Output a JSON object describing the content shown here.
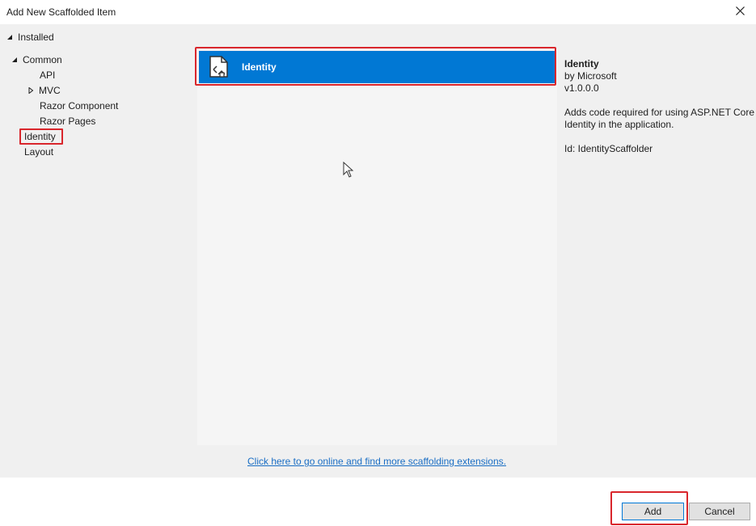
{
  "window": {
    "title": "Add New Scaffolded Item",
    "close_icon": "close-icon"
  },
  "tree": {
    "root_label": "Installed",
    "common_label": "Common",
    "children": [
      "API",
      "MVC",
      "Razor Component",
      "Razor Pages"
    ],
    "identity_label": "Identity",
    "layout_label": "Layout"
  },
  "list": {
    "items": [
      {
        "label": "Identity",
        "icon": "scaffold-document-icon",
        "selected": true
      }
    ]
  },
  "details": {
    "name": "Identity",
    "author": "by Microsoft",
    "version": "v1.0.0.0",
    "description": "Adds code required for using ASP.NET Core Identity in the application.",
    "id_line": "Id: IdentityScaffolder"
  },
  "link": {
    "text": "Click here to go online and find more scaffolding extensions."
  },
  "buttons": {
    "add": "Add",
    "cancel": "Cancel"
  },
  "colors": {
    "accent": "#0178d4",
    "highlight": "#d9262c",
    "panel": "#f0f0f0",
    "link": "#1a6ec4"
  }
}
